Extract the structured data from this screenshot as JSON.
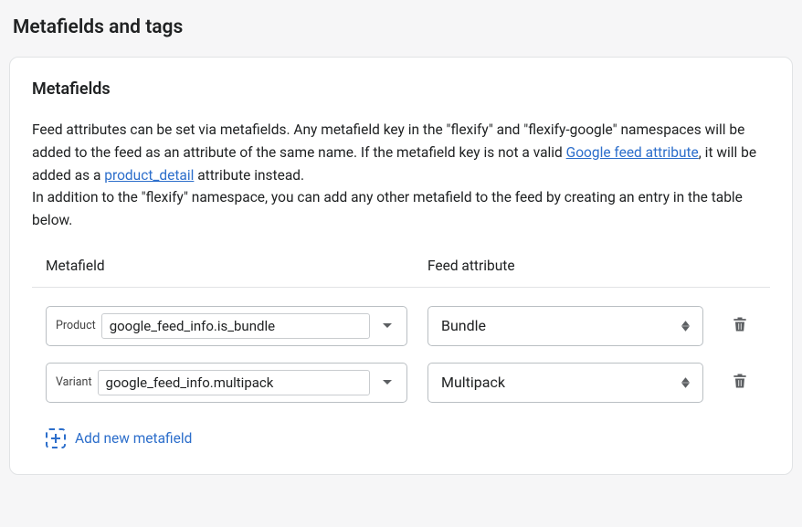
{
  "page": {
    "title": "Metafields and tags"
  },
  "card": {
    "title": "Metafields",
    "desc_part1": "Feed attributes can be set via metafields. Any metafield key in the \"flexify\" and \"flexify-google\" namespaces will be added to the feed as an attribute of the same name. If the metafield key is not a valid ",
    "link1": "Google feed attribute",
    "desc_part2": ", it will be added as a ",
    "link2": "product_detail",
    "desc_part3": " attribute instead.",
    "desc_part4": "In addition to the \"flexify\" namespace, you can add any other metafield to the feed by creating an entry in the table below."
  },
  "table": {
    "headers": {
      "metafield": "Metafield",
      "attribute": "Feed attribute"
    },
    "rows": [
      {
        "scope": "Product",
        "key": "google_feed_info.is_bundle",
        "attribute": "Bundle"
      },
      {
        "scope": "Variant",
        "key": "google_feed_info.multipack",
        "attribute": "Multipack"
      }
    ],
    "add_label": "Add new metafield"
  }
}
